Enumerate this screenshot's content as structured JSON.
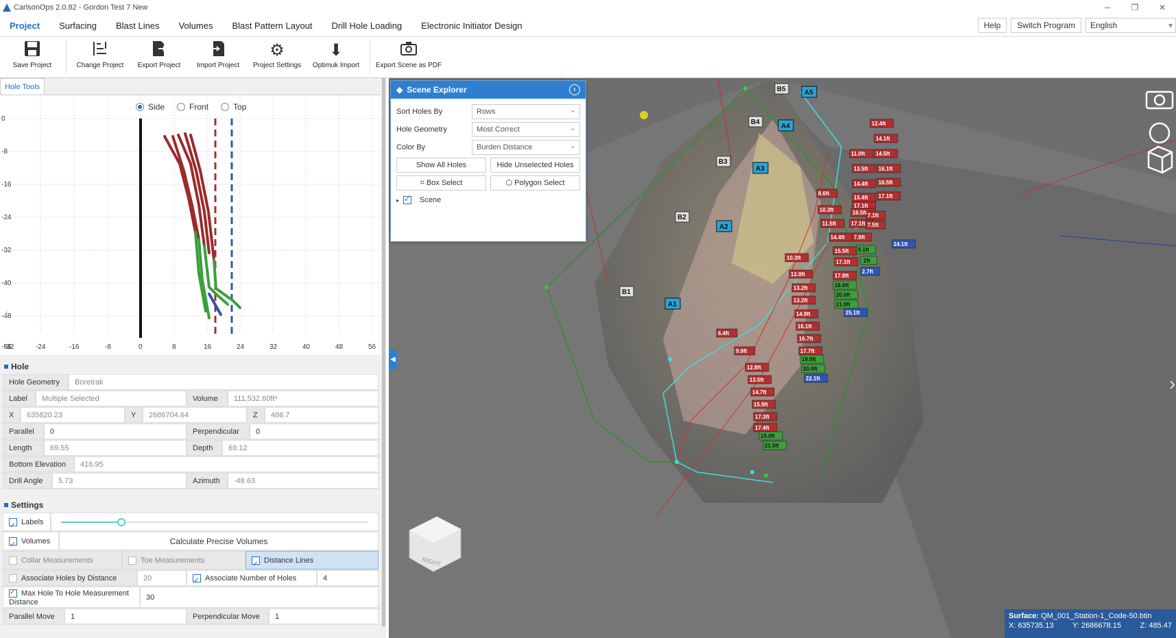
{
  "titlebar": {
    "title": "CarlsonOps 2.0.82 - Gordon Test 7 New"
  },
  "menu": {
    "tabs": [
      "Project",
      "Surfacing",
      "Blast Lines",
      "Volumes",
      "Blast Pattern Layout",
      "Drill Hole Loading",
      "Electronic Initiator Design"
    ],
    "help": "Help",
    "switch_program": "Switch Program",
    "language": "English"
  },
  "ribbon": {
    "save": "Save Project",
    "change": "Change Project",
    "export": "Export Project",
    "import": "Import Project",
    "settings": "Project Settings",
    "optimuk": "Optimuk Import",
    "pdf": "Export Scene as PDF"
  },
  "hole_tools": {
    "tab": "Hole Tools",
    "side": "Side",
    "front": "Front",
    "top": "Top"
  },
  "plot": {
    "xticks": [
      "-32",
      "-24",
      "-16",
      "-8",
      "0",
      "8",
      "16",
      "24",
      "32",
      "40",
      "48",
      "56"
    ],
    "yticks": [
      "0",
      "-8",
      "-16",
      "-24",
      "-32",
      "-40",
      "-48",
      "-56"
    ]
  },
  "hole": {
    "section": "Hole",
    "geometry_label": "Hole Geometry",
    "geometry_val": "Boretrak",
    "label_label": "Label",
    "label_val": "Multiple Selected",
    "volume_label": "Volume",
    "volume_val": "111,532.60ft³",
    "x_label": "X",
    "x_val": "635820.23",
    "y_label": "Y",
    "y_val": "2686704.64",
    "z_label": "Z",
    "z_val": "486.7",
    "parallel_label": "Parallel",
    "parallel_val": "0",
    "perp_label": "Perpendicular",
    "perp_val": "0",
    "length_label": "Length",
    "length_val": "69.55",
    "depth_label": "Depth",
    "depth_val": "69.12",
    "bottom_label": "Bottom Elevation",
    "bottom_val": "416.95",
    "angle_label": "Drill Angle",
    "angle_val": "5.73",
    "azimuth_label": "Azimuth",
    "azimuth_val": "-48.63"
  },
  "settings": {
    "section": "Settings",
    "labels": "Labels",
    "volumes": "Volumes",
    "calc": "Calculate Precise Volumes",
    "collar": "Collar Measurements",
    "toe": "Toe Measurements",
    "distance": "Distance Lines",
    "assoc_dist": "Associate Holes by Distance",
    "assoc_dist_val": "20",
    "assoc_num": "Associate Number of Holes",
    "assoc_num_val": "4",
    "max_hole": "Max Hole To Hole Measurement Distance",
    "max_hole_val": "30",
    "par_move": "Parallel Move",
    "par_move_val": "1",
    "perp_move": "Perpendicular Move",
    "perp_move_val": "1"
  },
  "explorer": {
    "title": "Scene Explorer",
    "sort_label": "Sort Holes By",
    "sort_val": "Rows",
    "geom_label": "Hole Geometry",
    "geom_val": "Most Correct",
    "color_label": "Color By",
    "color_val": "Burden Distance",
    "show_all": "Show All Holes",
    "hide_unsel": "Hide Unselected Holes",
    "box": "Box Select",
    "poly": "Polygon Select",
    "scene": "Scene"
  },
  "scene": {
    "holes": [
      "A1",
      "A2",
      "A3",
      "A4",
      "A5",
      "B1",
      "B2",
      "B3",
      "B4",
      "B5"
    ],
    "labels_red": [
      "12.4ft",
      "14.1ft",
      "11.0ft",
      "14.5ft",
      "13.5ft",
      "16.1ft",
      "16.5ft",
      "14.4ft",
      "17.1ft",
      "15.4ft",
      "17.1ft",
      "8.6ft",
      "16.5ft",
      "7.1ft",
      "10.3ft",
      "17.1ft",
      "7.5ft",
      "11.5ft",
      "14.4ft",
      "7.9ft",
      "15.5ft",
      "10.3ft",
      "17.1ft",
      "12.0ft",
      "17.8ft",
      "13.2ft",
      "13.2ft",
      "14.9ft",
      "16.1ft",
      "6.4ft",
      "16.7ft",
      "9.9ft",
      "17.7ft",
      "12.8ft",
      "13.5ft",
      "14.7ft",
      "15.9ft",
      "17.3ft",
      "17.4ft"
    ],
    "labels_green": [
      "9.1ft",
      "2ft",
      "18.6ft",
      "20.0ft",
      "21.0ft",
      "19.0ft",
      "20.0ft",
      "19.0ft",
      "21.0ft"
    ],
    "labels_blue": [
      "24.1ft",
      "2.7ft",
      "25.1ft",
      "22.1ft"
    ],
    "cube": "RIGHT"
  },
  "status": {
    "surface_label": "Surface:",
    "surface_val": "QM_001_Station-1_Code-50.btin",
    "x": "X: 635735.13",
    "y": "Y: 2686678.15",
    "z": "Z: 485.47"
  }
}
